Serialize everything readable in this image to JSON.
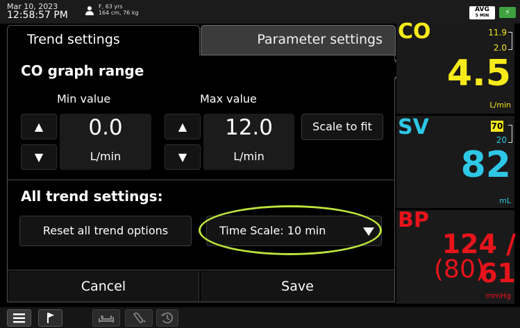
{
  "status_bar": {
    "date": "Mar 10, 2023",
    "time": "12:58:57 PM",
    "patient_line1": "F, 63 yrs",
    "patient_line2": "164 cm, 76 kg",
    "avg_label": "AVG",
    "avg_interval": "5 MIN",
    "battery_symbol": "⚡"
  },
  "tabs": {
    "trend": "Trend settings",
    "parameter": "Parameter settings"
  },
  "graph_range": {
    "title": "CO graph range",
    "min_label": "Min value",
    "max_label": "Max value",
    "min_value": "0.0",
    "max_value": "12.0",
    "unit": "L/min",
    "scale_to_fit": "Scale to fit",
    "up_symbol": "▲",
    "down_symbol": "▼"
  },
  "all_trend": {
    "title": "All trend settings:",
    "reset_label": "Reset all trend options",
    "time_scale_label": "Time Scale: 10 min"
  },
  "footer": {
    "cancel": "Cancel",
    "save": "Save"
  },
  "parameters": {
    "co": {
      "name": "CO",
      "value": "4.5",
      "unit": "L/min",
      "target_high": "11.9",
      "target_low": "2.0",
      "color": "#f7ea1a"
    },
    "sv": {
      "name": "SV",
      "value": "82",
      "unit": "mL",
      "target_high": "70",
      "target_low": "20",
      "color": "#2ec7e6"
    },
    "bp": {
      "name": "BP",
      "value": "124 / 61",
      "map": "(80)",
      "unit": "mmHg",
      "color": "#e8141b"
    }
  },
  "colors": {
    "highlight": "#bde33b",
    "battery": "#3fa23f"
  },
  "icons": [
    "patient-icon",
    "menu-icon",
    "flag-icon",
    "bed-icon",
    "sensor-icon",
    "history-icon",
    "dropdown-arrow-icon"
  ]
}
